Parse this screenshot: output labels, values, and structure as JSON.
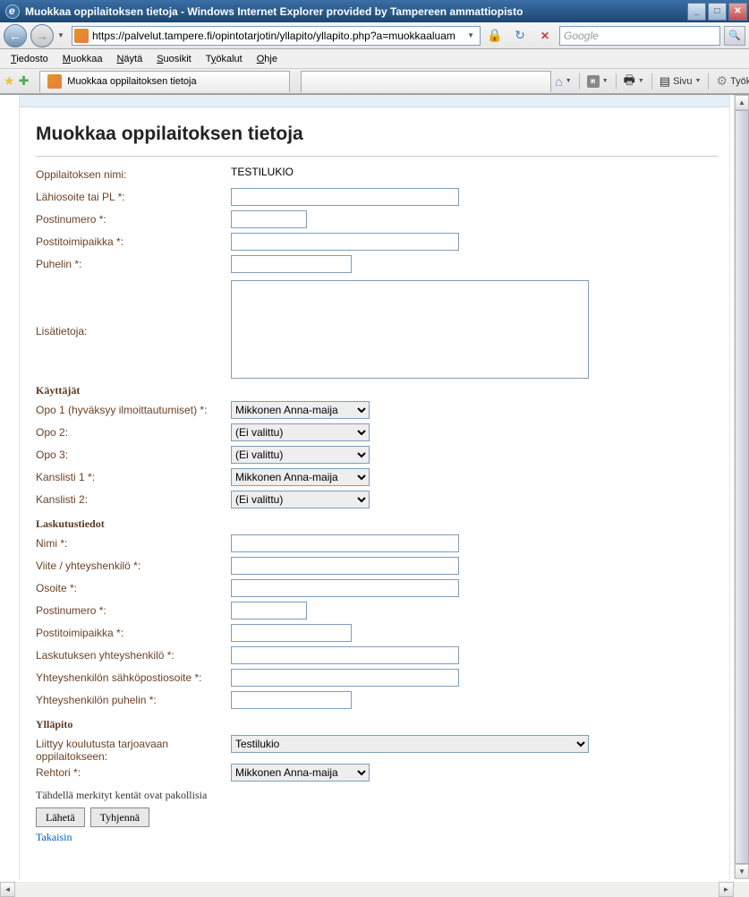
{
  "window": {
    "title": "Muokkaa oppilaitoksen tietoja - Windows Internet Explorer provided by Tampereen ammattiopisto"
  },
  "nav": {
    "url": "https://palvelut.tampere.fi/opintotarjotin/yllapito/yllapito.php?a=muokkaaluam",
    "search_placeholder": "Google"
  },
  "menu": {
    "file": "Tiedosto",
    "edit": "Muokkaa",
    "view": "Näytä",
    "favorites": "Suosikit",
    "tools": "Työkalut",
    "help": "Ohje"
  },
  "tab": {
    "title": "Muokkaa oppilaitoksen tietoja"
  },
  "toolbar": {
    "page": "Sivu",
    "tools": "Työkalut"
  },
  "form": {
    "heading": "Muokkaa oppilaitoksen tietoja",
    "labels": {
      "nimi": "Oppilaitoksen nimi:",
      "lahiosoite": "Lähiosoite tai PL *:",
      "postinumero": "Postinumero *:",
      "postitoimipaikka": "Postitoimipaikka *:",
      "puhelin": "Puhelin *:",
      "lisatietoja": "Lisätietoja:",
      "kayttajat": "Käyttäjät",
      "opo1": "Opo 1 (hyväksyy ilmoittautumiset) *:",
      "opo2": "Opo 2:",
      "opo3": "Opo 3:",
      "kanslisti1": "Kanslisti 1 *:",
      "kanslisti2": "Kanslisti 2:",
      "laskutustiedot": "Laskutustiedot",
      "l_nimi": "Nimi *:",
      "l_viite": "Viite / yhteyshenkilö *:",
      "l_osoite": "Osoite *:",
      "l_postinumero": "Postinumero *:",
      "l_postitoimipaikka": "Postitoimipaikka *:",
      "l_yhteys": "Laskutuksen yhteyshenkilö *:",
      "l_email": "Yhteyshenkilön sähköpostiosoite *:",
      "l_puhelin": "Yhteyshenkilön puhelin *:",
      "yllapito": "Ylläpito",
      "liittyy": "Liittyy koulutusta tarjoavaan oppilaitokseen:",
      "rehtori": "Rehtori *:"
    },
    "values": {
      "nimi": "TESTILUKIO",
      "opo1": "Mikkonen Anna-maija",
      "opo2": "(Ei valittu)",
      "opo3": "(Ei valittu)",
      "kanslisti1": "Mikkonen Anna-maija",
      "kanslisti2": "(Ei valittu)",
      "liittyy": "Testilukio",
      "rehtori": "Mikkonen Anna-maija"
    },
    "note": "Tähdellä merkityt kentät ovat pakollisia",
    "submit": "Lähetä",
    "reset": "Tyhjennä",
    "back": "Takaisin"
  }
}
